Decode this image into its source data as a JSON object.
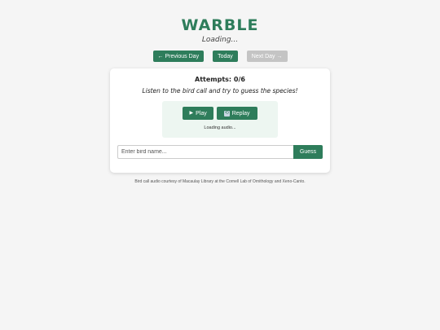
{
  "app": {
    "title": "WARBLE",
    "subtitle": "Loading..."
  },
  "nav": {
    "previous_label": "← Previous Day",
    "today_label": "Today",
    "next_label": "Next Day →"
  },
  "game": {
    "attempts_label": "Attempts: 0/6",
    "instructions": "Listen to the bird call and try to guess the species!",
    "player": {
      "play_icon": "play-icon",
      "play_label": "Play",
      "replay_icon": "replay-icon",
      "replay_label": "Replay",
      "status": "Loading audio..."
    },
    "guess": {
      "placeholder": "Enter bird name...",
      "value": "",
      "button_label": "Guess"
    }
  },
  "footer": {
    "credit": "Bird call audio courtesy of Macaulay Library at the Cornell Lab of Ornithology and Xeno-Canto."
  },
  "colors": {
    "accent": "#2e7d5b",
    "disabled": "#c4c4c4",
    "background": "#f5f5f5",
    "player_bg": "#edf6f1"
  }
}
